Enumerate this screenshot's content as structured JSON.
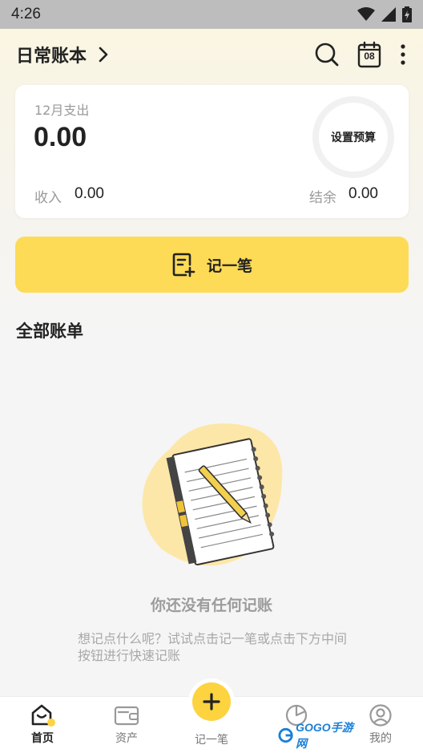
{
  "status_bar": {
    "time": "4:26"
  },
  "header": {
    "book_title": "日常账本",
    "calendar_day": "08"
  },
  "summary": {
    "month_label": "12月支出",
    "month_amount": "0.00",
    "budget_label": "设置预算",
    "income_label": "收入",
    "income_value": "0.00",
    "balance_label": "结余",
    "balance_value": "0.00"
  },
  "record_button": {
    "label": "记一笔"
  },
  "section": {
    "title": "全部账单"
  },
  "empty_state": {
    "title": "你还没有任何记账",
    "hint": "想记点什么呢？试试点击记一笔或点击下方中间按钮进行快速记账"
  },
  "bottom_nav": {
    "home": "首页",
    "assets": "资产",
    "record": "记一笔",
    "stats": "",
    "mine": "我的"
  },
  "watermark": {
    "text": "GOGO手游网"
  },
  "colors": {
    "accent": "#fddb56",
    "fab": "#fdd33f",
    "status_bar": "#bdbdbd"
  },
  "icons": {
    "search": "search-icon",
    "calendar": "calendar-icon",
    "more": "more-vertical-icon",
    "chevron": "chevron-right-icon",
    "record": "add-note-icon",
    "home": "home-icon",
    "assets": "wallet-icon",
    "stats": "pie-chart-icon",
    "mine": "user-icon"
  }
}
